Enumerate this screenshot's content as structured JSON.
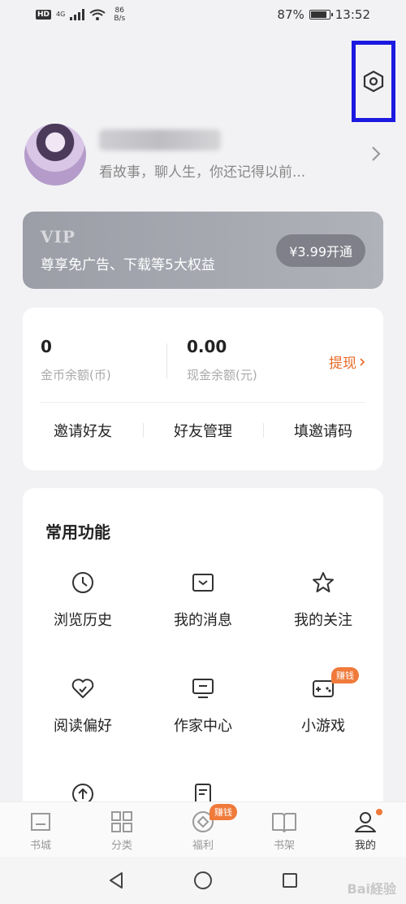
{
  "status_bar": {
    "hd": "HD",
    "network": "4G",
    "speed_value": "86",
    "speed_unit": "B/s",
    "battery": "87%",
    "time": "13:52"
  },
  "profile": {
    "bio": "看故事，聊人生，你还记得以前..."
  },
  "vip": {
    "title": "VIP",
    "desc": "尊享免广告、下载等5大权益",
    "button": "¥3.99开通"
  },
  "wallet": {
    "coins_value": "0",
    "coins_label": "金币余额(币)",
    "cash_value": "0.00",
    "cash_label": "现金余额(元)",
    "withdraw": "提现",
    "links": [
      "邀请好友",
      "好友管理",
      "填邀请码"
    ]
  },
  "functions": {
    "title": "常用功能",
    "items": [
      {
        "label": "浏览历史",
        "icon": "clock-icon"
      },
      {
        "label": "我的消息",
        "icon": "message-icon"
      },
      {
        "label": "我的关注",
        "icon": "star-icon"
      },
      {
        "label": "阅读偏好",
        "icon": "heart-icon"
      },
      {
        "label": "作家中心",
        "icon": "monitor-icon"
      },
      {
        "label": "小游戏",
        "icon": "gamepad-icon",
        "badge": "赚钱"
      }
    ]
  },
  "tabbar": {
    "items": [
      {
        "label": "书城",
        "icon": "bookstore-icon"
      },
      {
        "label": "分类",
        "icon": "grid-icon"
      },
      {
        "label": "福利",
        "icon": "gift-icon",
        "badge": "赚钱"
      },
      {
        "label": "书架",
        "icon": "book-icon"
      },
      {
        "label": "我的",
        "icon": "user-icon",
        "active": true
      }
    ]
  },
  "watermark": "Bai経验",
  "colors": {
    "accent": "#f07a3a",
    "highlight": "#1c19e0",
    "vip_bg": "#a6a8b0"
  }
}
